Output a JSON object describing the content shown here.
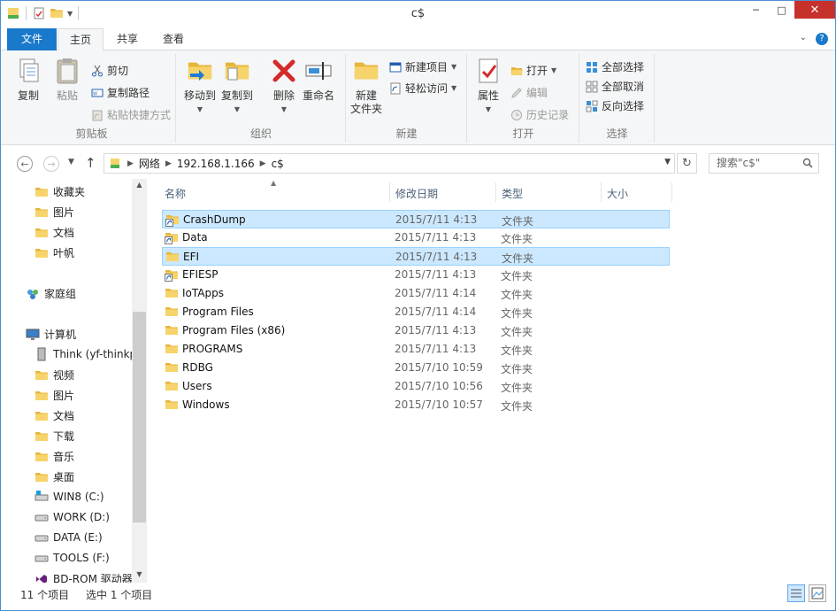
{
  "window": {
    "title": "c$"
  },
  "titlebar": {
    "minimize_glyph": "─",
    "maximize_glyph": "□",
    "close_glyph": "✕"
  },
  "tabs": {
    "file": "文件",
    "home": "主页",
    "share": "共享",
    "view": "查看"
  },
  "ribbon": {
    "clipboard": {
      "label": "剪贴板",
      "copy": "复制",
      "paste": "粘贴",
      "cut": "剪切",
      "copy_path": "复制路径",
      "paste_shortcut": "粘贴快捷方式"
    },
    "organize": {
      "label": "组织",
      "move_to": "移动到",
      "copy_to": "复制到",
      "delete": "删除",
      "rename": "重命名"
    },
    "new": {
      "label": "新建",
      "new_folder_line1": "新建",
      "new_folder_line2": "文件夹",
      "new_item": "新建项目",
      "easy_access": "轻松访问"
    },
    "open": {
      "label": "打开",
      "properties": "属性",
      "open": "打开",
      "edit": "编辑",
      "history": "历史记录"
    },
    "select": {
      "label": "选择",
      "select_all": "全部选择",
      "select_none": "全部取消",
      "invert": "反向选择"
    }
  },
  "address": {
    "crumbs": [
      "网络",
      "192.168.1.166",
      "c$"
    ],
    "search_placeholder": "搜索\"c$\""
  },
  "navpane": {
    "favorites": "收藏夹",
    "fav_items": [
      "图片",
      "文档",
      "叶帆"
    ],
    "homegroup": "家庭组",
    "computer": "计算机",
    "computer_items": [
      "Think (yf-thinkp",
      "视频",
      "图片",
      "文档",
      "下载",
      "音乐",
      "桌面",
      "WIN8 (C:)",
      "WORK (D:)",
      "DATA (E:)",
      "TOOLS (F:)",
      "BD-ROM 驱动器"
    ]
  },
  "columns": {
    "name": "名称",
    "date": "修改日期",
    "type": "类型",
    "size": "大小"
  },
  "files": [
    {
      "name": "CrashDump",
      "date": "2015/7/11 4:13",
      "type": "文件夹",
      "shortcut": true,
      "selected": true
    },
    {
      "name": "Data",
      "date": "2015/7/11 4:13",
      "type": "文件夹",
      "shortcut": true,
      "selected": false
    },
    {
      "name": "EFI",
      "date": "2015/7/11 4:13",
      "type": "文件夹",
      "shortcut": false,
      "selected": true
    },
    {
      "name": "EFIESP",
      "date": "2015/7/11 4:13",
      "type": "文件夹",
      "shortcut": true,
      "selected": false
    },
    {
      "name": "IoTApps",
      "date": "2015/7/11 4:14",
      "type": "文件夹",
      "shortcut": false,
      "selected": false
    },
    {
      "name": "Program Files",
      "date": "2015/7/11 4:14",
      "type": "文件夹",
      "shortcut": false,
      "selected": false
    },
    {
      "name": "Program Files (x86)",
      "date": "2015/7/11 4:13",
      "type": "文件夹",
      "shortcut": false,
      "selected": false
    },
    {
      "name": "PROGRAMS",
      "date": "2015/7/11 4:13",
      "type": "文件夹",
      "shortcut": false,
      "selected": false
    },
    {
      "name": "RDBG",
      "date": "2015/7/10 10:59",
      "type": "文件夹",
      "shortcut": false,
      "selected": false
    },
    {
      "name": "Users",
      "date": "2015/7/10 10:56",
      "type": "文件夹",
      "shortcut": false,
      "selected": false
    },
    {
      "name": "Windows",
      "date": "2015/7/10 10:57",
      "type": "文件夹",
      "shortcut": false,
      "selected": false
    }
  ],
  "status": {
    "count": "11 个项目",
    "selected": "选中 1 个项目"
  },
  "colors": {
    "accent": "#1979ca",
    "selection": "#cce8ff",
    "selection_border": "#99d1ff",
    "folder": "#e8b53b"
  }
}
